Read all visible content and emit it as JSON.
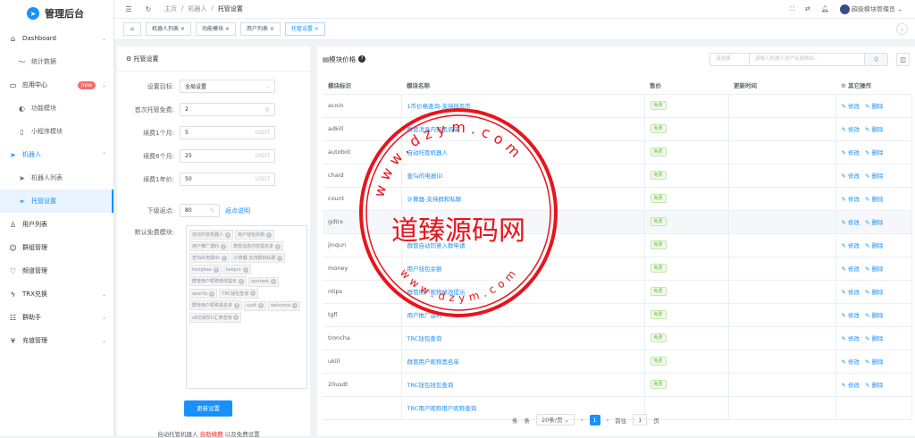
{
  "app": {
    "title": "管理后台"
  },
  "sidebar": {
    "items": [
      {
        "label": "Dashboard",
        "icon": "home-icon",
        "level": 1,
        "chevron": true
      },
      {
        "label": "统计数据",
        "icon": "trend-icon",
        "level": 2
      },
      {
        "label": "应用中心",
        "icon": "app-icon",
        "level": 1,
        "chevron": true,
        "badge": "new"
      },
      {
        "label": "功能模块",
        "icon": "toggle-icon",
        "level": 2
      },
      {
        "label": "小程序模块",
        "icon": "phone-icon",
        "level": 2
      },
      {
        "label": "机器人",
        "icon": "send-icon",
        "level": 1,
        "chevron": true,
        "open": true
      },
      {
        "label": "机器人列表",
        "icon": "send-icon",
        "level": 2
      },
      {
        "label": "托管设置",
        "icon": "link-icon",
        "level": 2,
        "active": true
      },
      {
        "label": "用户列表",
        "icon": "user-icon",
        "level": 1
      },
      {
        "label": "群组管理",
        "icon": "group-icon",
        "level": 1
      },
      {
        "label": "频道管理",
        "icon": "heart-icon",
        "level": 1
      },
      {
        "label": "TRX兑换",
        "icon": "bolt-icon",
        "level": 1,
        "chevron": true
      },
      {
        "label": "群助手",
        "icon": "helper-icon",
        "level": 1,
        "chevron": true
      },
      {
        "label": "充值管理",
        "icon": "yen-icon",
        "level": 1,
        "chevron": true
      }
    ]
  },
  "topbar": {
    "breadcrumb": [
      "主页",
      "/",
      "机器人",
      "/",
      "托管设置"
    ],
    "user": "超级模块管理员"
  },
  "tags": [
    "机器人列表",
    "功能模块",
    "用户列表",
    "托管设置"
  ],
  "left": {
    "title": "托管设置",
    "fields": [
      {
        "label": "设置目标:",
        "value": "全局设置",
        "suffix": "⌄"
      },
      {
        "label": "首次托管免费:",
        "value": "2",
        "suffix": "天"
      },
      {
        "label": "续费1个月:",
        "value": "5",
        "suffix": "USDT"
      },
      {
        "label": "续费6个月:",
        "value": "25",
        "suffix": "USDT"
      },
      {
        "label": "续费1年价:",
        "value": "50",
        "suffix": "USDT"
      }
    ],
    "rebate": {
      "label": "下级返点:",
      "value": "80",
      "suffix": "%",
      "link": "返点说明"
    },
    "free_label": "默认免费模块:",
    "chips": [
      "自动托管机器人",
      "用户钱包余额",
      "用户推广邀利",
      "群管消息内容黑名单",
      "查Ta的电报ID",
      "计算器-支持群和私聊",
      "hongbao",
      "kaiqun",
      "群管用户昵称修改提示",
      "quntask",
      "qverify",
      "TRC钱包查询",
      "群管用户昵称黑名单",
      "usdt",
      "welcome",
      "z8交易所U汇率查询"
    ],
    "save_button": "更新设置",
    "note_pre": "自动托管机器人",
    "note_red": "自助续费",
    "note_post": "以及免费设置"
  },
  "right": {
    "title": "模块价格",
    "filter": {
      "select": "请选择",
      "placeholder": "请输入机器人用户名或群ID...",
      "search": "Q"
    },
    "columns": [
      "模块标识",
      "模块名称",
      "售价",
      "更新时间",
      "其它操作"
    ],
    "rows": [
      {
        "id": "acoin",
        "name": "1币价格查询-支持所有币",
        "price": "免费"
      },
      {
        "id": "adkill",
        "name": "群管消息内容黑名单",
        "price": "免费"
      },
      {
        "id": "autobot",
        "name": "自动托管机器人",
        "price": "免费"
      },
      {
        "id": "chaid",
        "name": "查Ta的电报ID",
        "price": "免费"
      },
      {
        "id": "count",
        "name": "计算器-支持群和私聊",
        "price": "免费"
      },
      {
        "id": "gdtrx",
        "name": "",
        "price": "免费"
      },
      {
        "id": "jinqun",
        "name": "群管自动同意入群申请",
        "price": "免费"
      },
      {
        "id": "money",
        "name": "用户钱包余额",
        "price": "免费"
      },
      {
        "id": "ntips",
        "name": "群管用户昵称修改提示",
        "price": "免费"
      },
      {
        "id": "tgfl",
        "name": "用户推广返利",
        "price": "免费"
      },
      {
        "id": "troncha",
        "name": "TRC钱包查询",
        "price": "免费"
      },
      {
        "id": "ukill",
        "name": "群管用户昵称黑名单",
        "price": "免费"
      },
      {
        "id": "20usdt",
        "name": "TRC钱包钱包查询",
        "price": "免费"
      },
      {
        "id": "",
        "name": "TRC用户昵称用户昵称查询",
        "price": ""
      }
    ],
    "op_edit": "修改",
    "op_delete": "删除",
    "pagination": {
      "total": "条",
      "per_page": "20条/页",
      "page": "1",
      "goto": "前往",
      "goto_value": "1",
      "page_unit": "页"
    }
  },
  "watermark": {
    "text": "道臻源码网",
    "ring_top": "www.dzym.com",
    "ring_bottom": "www.dzym.com",
    "color": "#e8141c"
  }
}
